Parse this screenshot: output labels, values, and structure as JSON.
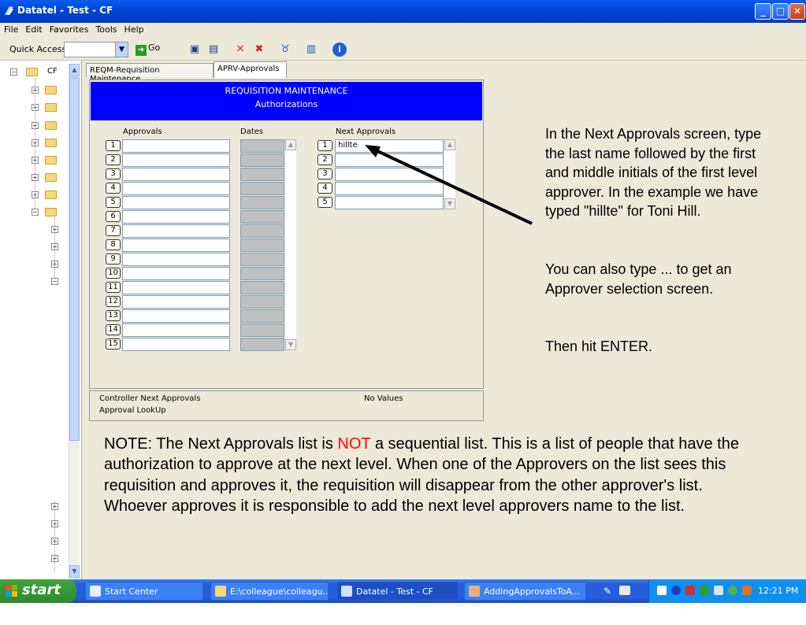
{
  "window": {
    "title": "Datatel - Test - CF"
  },
  "menu": [
    "File",
    "Edit",
    "Favorites",
    "Tools",
    "Help"
  ],
  "toolbar": {
    "quick_access_label": "Quick Access",
    "quick_access_value": "",
    "go_label": "Go"
  },
  "tree": {
    "root_label": "CF"
  },
  "tabs": [
    {
      "label": "REQM-Requisition Maintenance",
      "active": false
    },
    {
      "label": "APRV-Approvals",
      "active": true
    }
  ],
  "form": {
    "banner_title": "REQUISITION MAINTENANCE",
    "banner_subtitle": "Authorizations",
    "col_approvals": "Approvals",
    "col_dates": "Dates",
    "col_next_approvals": "Next Approvals",
    "approval_rows": [
      "1",
      "2",
      "3",
      "4",
      "5",
      "6",
      "7",
      "8",
      "9",
      "10",
      "11",
      "12",
      "13",
      "14",
      "15"
    ],
    "next_approval_rows": [
      {
        "num": "1",
        "value": "hillte"
      },
      {
        "num": "2",
        "value": ""
      },
      {
        "num": "3",
        "value": ""
      },
      {
        "num": "4",
        "value": ""
      },
      {
        "num": "5",
        "value": ""
      }
    ],
    "footer_line1": "Controller Next Approvals",
    "footer_line2": "Approval LookUp",
    "footer_status": "No Values"
  },
  "instructions": {
    "p1": "In the Next Approvals screen, type the last name followed by the first and middle initials of the first level approver. In the example we have typed \"hillte\" for Toni Hill.",
    "p2": "You can also type ... to get an Approver selection screen.",
    "p3": "Then hit ENTER."
  },
  "note": {
    "before": "NOTE:  The Next Approvals list is ",
    "highlight": "NOT",
    "after": " a sequential list.  This is a list of people that have the authorization to approve at the next level.  When one of the Approvers on the list sees this requisition and approves it, the requisition will disappear from the other approver's list.  Whoever approves it is responsible to add the next level approvers name to the list."
  },
  "taskbar": {
    "start": "start",
    "tasks": [
      {
        "label": "Start Center"
      },
      {
        "label": "E:\\colleague\\colleagu..."
      },
      {
        "label": "Datatel - Test - CF"
      },
      {
        "label": "AddingApprovalsToA..."
      }
    ],
    "clock": "12:21 PM"
  },
  "colors": {
    "banner": "#0000ff",
    "highlight": "#ff0000",
    "taskbar": "#245edb",
    "start": "#2e8b2e"
  }
}
